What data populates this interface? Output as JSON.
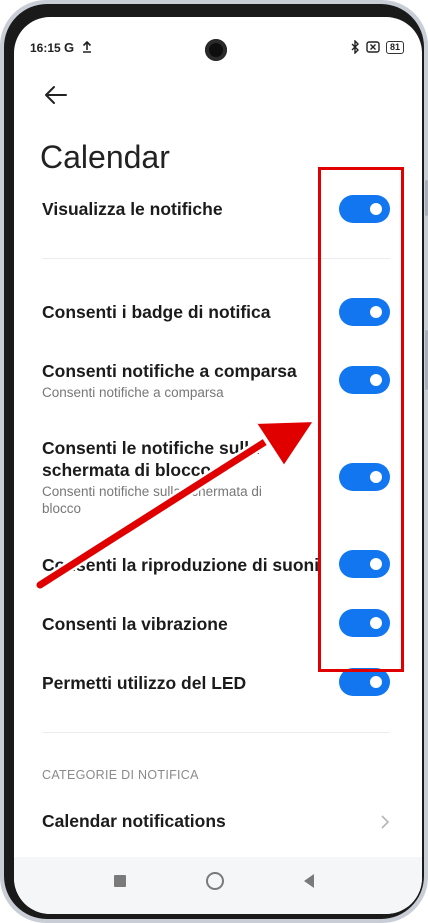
{
  "status_bar": {
    "time": "16:15",
    "g_label": "G",
    "upload_icon": "upload-arrow",
    "bluetooth_icon": "bluetooth",
    "sim_icon": "sim-x",
    "battery": "81"
  },
  "header": {
    "back_icon": "arrow-left",
    "title": "Calendar"
  },
  "settings": [
    {
      "title": "Visualizza le notifiche",
      "subtitle": "",
      "on": true
    },
    {
      "title": "Consenti i badge di notifica",
      "subtitle": "",
      "on": true
    },
    {
      "title": "Consenti notifiche a comparsa",
      "subtitle": "Consenti notifiche a comparsa",
      "on": true
    },
    {
      "title": "Consenti le notifiche sulla schermata di blocco",
      "subtitle": "Consenti notifiche sulla schermata di blocco",
      "on": true
    },
    {
      "title": "Consenti la riproduzione di suoni",
      "subtitle": "",
      "on": true
    },
    {
      "title": "Consenti la vibrazione",
      "subtitle": "",
      "on": true
    },
    {
      "title": "Permetti utilizzo del LED",
      "subtitle": "",
      "on": true
    }
  ],
  "section": {
    "label": "CATEGORIE DI NOTIFICA"
  },
  "category": {
    "title": "Calendar notifications",
    "icon": "chevron-right"
  },
  "nav": {
    "recents_icon": "square",
    "home_icon": "circle",
    "back_icon": "triangle-left"
  },
  "colors": {
    "accent": "#1276f0",
    "annotation": "#e00000"
  }
}
